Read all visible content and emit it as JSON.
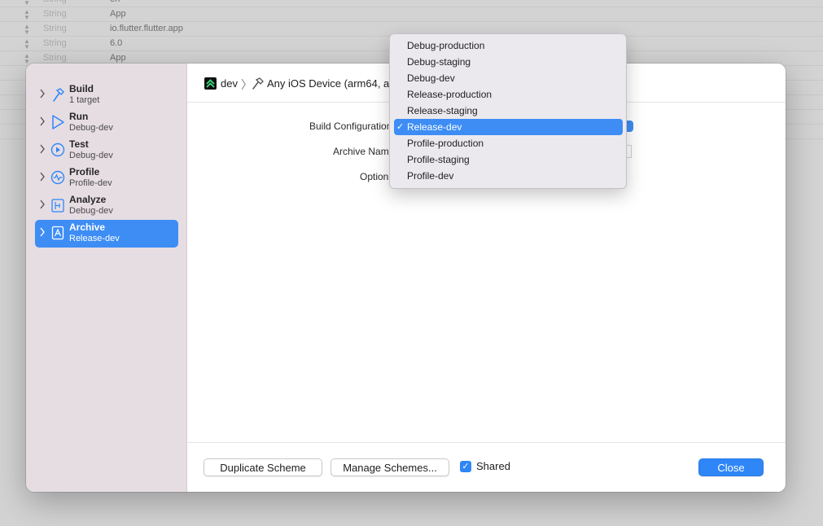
{
  "background_rows": [
    {
      "type": "String",
      "value": "en"
    },
    {
      "type": "String",
      "value": "App"
    },
    {
      "type": "String",
      "value": "io.flutter.flutter.app"
    },
    {
      "type": "String",
      "value": "6.0"
    },
    {
      "type": "String",
      "value": "App"
    }
  ],
  "sidebar": {
    "items": [
      {
        "title": "Build",
        "subtitle": "1 target",
        "icon": "hammer-icon"
      },
      {
        "title": "Run",
        "subtitle": "Debug-dev",
        "icon": "play-icon"
      },
      {
        "title": "Test",
        "subtitle": "Debug-dev",
        "icon": "test-diamond-icon"
      },
      {
        "title": "Profile",
        "subtitle": "Profile-dev",
        "icon": "profile-gauge-icon"
      },
      {
        "title": "Analyze",
        "subtitle": "Debug-dev",
        "icon": "analyze-icon"
      },
      {
        "title": "Archive",
        "subtitle": "Release-dev",
        "icon": "archive-icon"
      }
    ],
    "selected_index": 5
  },
  "scheme_bar": {
    "scheme": "dev",
    "separator": "〉",
    "device": "Any iOS Device (arm64, a"
  },
  "form": {
    "build_configuration_label": "Build Configuration",
    "archive_name_label": "Archive Name",
    "options_label": "Options"
  },
  "menu": {
    "items": [
      "Debug-production",
      "Debug-staging",
      "Debug-dev",
      "Release-production",
      "Release-staging",
      "Release-dev",
      "Profile-production",
      "Profile-staging",
      "Profile-dev"
    ],
    "selected_index": 5,
    "check_glyph": "✓"
  },
  "footer": {
    "duplicate_label": "Duplicate Scheme",
    "manage_label": "Manage Schemes...",
    "shared_label": "Shared",
    "shared_checked": true,
    "close_label": "Close"
  },
  "colors": {
    "accent": "#3d8df5",
    "sidebar_bg": "#e6dde3",
    "menu_bg": "#ece9ee"
  }
}
